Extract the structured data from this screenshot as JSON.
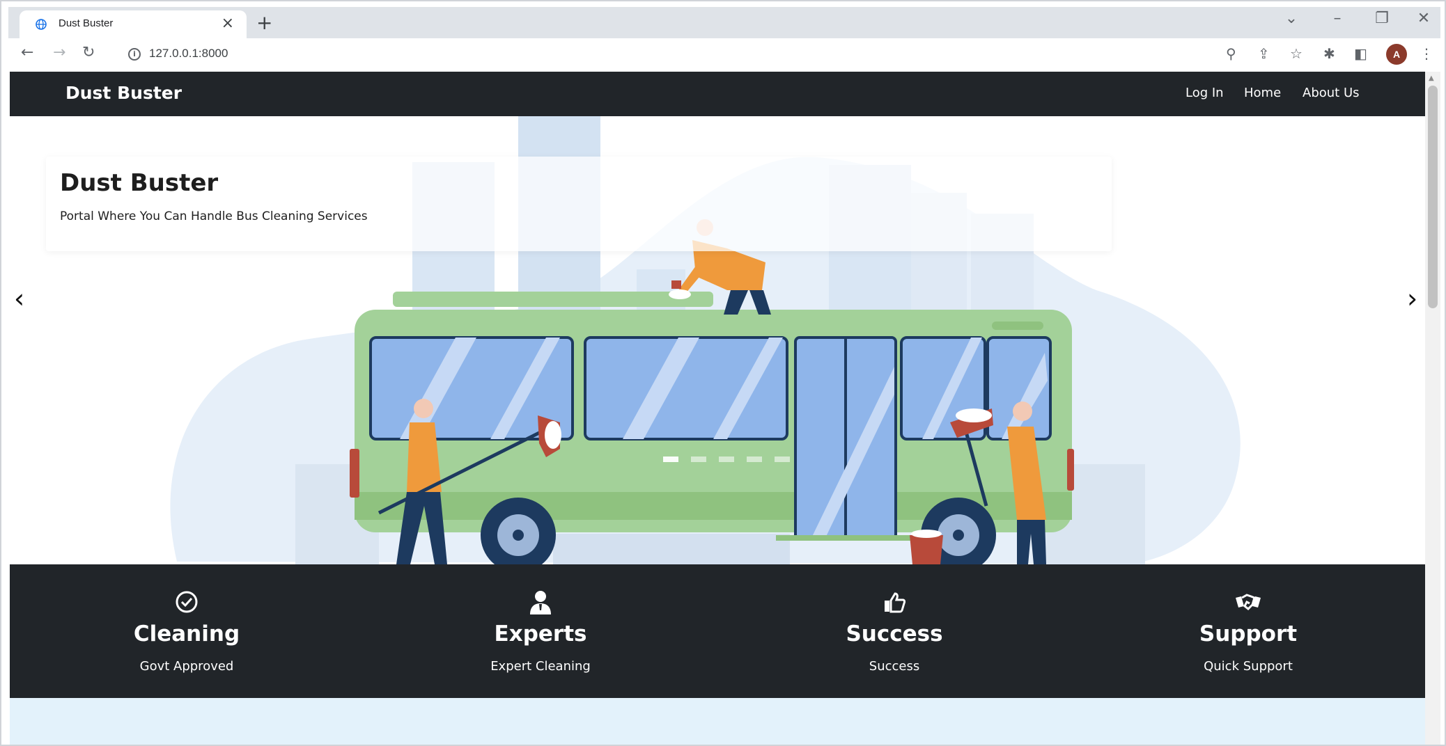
{
  "browser": {
    "tab_title": "Dust Buster",
    "url": "127.0.0.1:8000",
    "profile_initial": "A"
  },
  "navbar": {
    "brand": "Dust Buster",
    "links": [
      "Log In",
      "Home",
      "About Us"
    ]
  },
  "carousel": {
    "title": "Dust Buster",
    "subtitle": "Portal Where You Can Handle Bus Cleaning Services",
    "slide_count": 5,
    "active_slide": 1
  },
  "features": [
    {
      "icon": "check-circle-icon",
      "title": "Cleaning",
      "subtitle": "Govt Approved"
    },
    {
      "icon": "user-tie-icon",
      "title": "Experts",
      "subtitle": "Expert Cleaning"
    },
    {
      "icon": "thumbs-up-icon",
      "title": "Success",
      "subtitle": "Success"
    },
    {
      "icon": "handshake-icon",
      "title": "Support",
      "subtitle": "Quick Support"
    }
  ],
  "colors": {
    "navbar_bg": "#212529",
    "bus_green": "#a3d199",
    "worker_orange": "#ef9a3c",
    "band_bg": "#e3f2fb"
  }
}
